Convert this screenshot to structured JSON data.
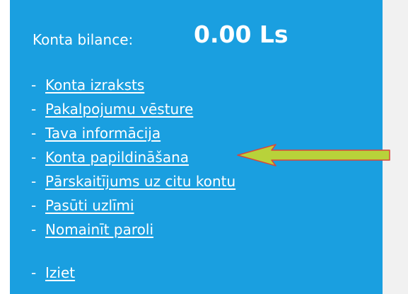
{
  "account": {
    "balance_label": "Konta bilance:",
    "balance_value": "0.00 Ls"
  },
  "menu": {
    "bullet": "-",
    "items": [
      {
        "label": "Konta izraksts"
      },
      {
        "label": "Pakalpojumu vēsture"
      },
      {
        "label": "Tava informācija"
      },
      {
        "label": "Konta papildināšana"
      },
      {
        "label": "Pārskaitījums uz citu kontu"
      },
      {
        "label": "Pasūti uzlīmi"
      },
      {
        "label": "Nomainīt paroli"
      }
    ],
    "logout_label": "Iziet"
  },
  "colors": {
    "panel_background": "#1a9fe0",
    "text": "#ffffff",
    "arrow_fill": "#b8d23a",
    "arrow_outline": "#d9463a",
    "right_strip": "#f1f1f1"
  },
  "annotation": {
    "icon": "arrow-left-icon"
  }
}
